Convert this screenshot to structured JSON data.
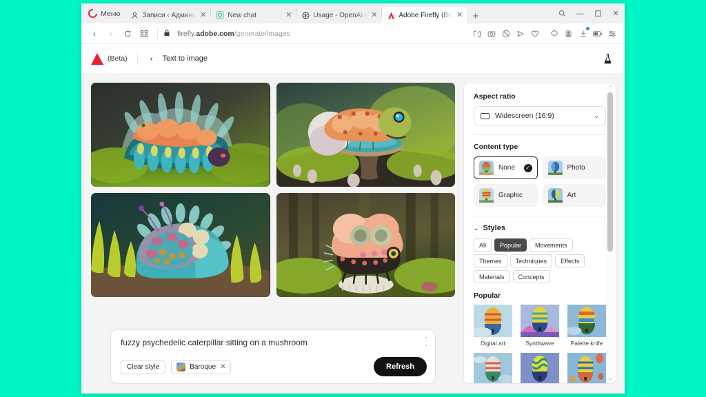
{
  "desktop": {
    "background_color": "#00f5c4"
  },
  "browser": {
    "menu": {
      "label": "Меню",
      "icon": "opera-logo-icon"
    },
    "tabs": [
      {
        "title": "Записи ‹ Админкин — Wo",
        "favicon": "user-icon",
        "active": false,
        "close": "✕"
      },
      {
        "title": "New chat",
        "favicon": "chat-icon",
        "active": false,
        "close": "✕"
      },
      {
        "title": "Usage - OpenAI API",
        "favicon": "openai-icon",
        "active": false,
        "close": "✕"
      },
      {
        "title": "Adobe Firefly (Beta)",
        "favicon": "adobe-firefly-icon",
        "active": true,
        "close": "✕"
      }
    ],
    "new_tab_label": "+",
    "window_controls": {
      "search": "search-icon",
      "minimize": "—",
      "maximize": "▢",
      "close": "✕"
    },
    "nav": {
      "back": "‹",
      "forward": "›",
      "reload": "⟳",
      "tabs_overview": "▤"
    },
    "address": {
      "lock": "lock-icon",
      "url_prefix": "firefly.",
      "url_host": "adobe.com",
      "url_path": "/generate/images"
    },
    "toolbar_icons": [
      "snapshot-icon",
      "camera-icon",
      "adblock-icon",
      "messenger-icon",
      "heart-icon",
      "extensions-icon",
      "profile-icon",
      "downloads-icon",
      "battery-icon",
      "settings-icon"
    ]
  },
  "app": {
    "logo": "adobe-firefly-logo",
    "beta_label": "(Beta)",
    "back_arrow": "‹",
    "page_title": "Text to image",
    "lab_icon": "flask-icon"
  },
  "results": {
    "images": [
      {
        "alt": "teal and orange fuzzy caterpillar on green moss"
      },
      {
        "alt": "orange spiky caterpillar sitting on a teal mushroom"
      },
      {
        "alt": "round teal caterpillar with berry textures and antennae"
      },
      {
        "alt": "fuzzy googly-eyed caterpillar on a white mushroom in forest"
      }
    ]
  },
  "prompt": {
    "text": "fuzzy psychedelic caterpillar sitting on a mushroom",
    "stepper_up": "⌃",
    "stepper_down": "⌄",
    "clear_style_label": "Clear style",
    "style_chip": {
      "label": "Baroque",
      "remove": "✕"
    },
    "refresh_label": "Refresh"
  },
  "panel": {
    "aspect_ratio": {
      "title": "Aspect ratio",
      "value": "Widescreen (16:9)",
      "caret": "⌄",
      "icon": "rectangle-icon"
    },
    "content_type": {
      "title": "Content type",
      "options": [
        {
          "label": "None",
          "selected": true,
          "check": "✓"
        },
        {
          "label": "Photo",
          "selected": false,
          "check": ""
        },
        {
          "label": "Graphic",
          "selected": false,
          "check": ""
        },
        {
          "label": "Art",
          "selected": false,
          "check": ""
        }
      ]
    },
    "styles": {
      "title": "Styles",
      "chevron": "⌄",
      "filters": [
        {
          "label": "All",
          "active": false
        },
        {
          "label": "Popular",
          "active": true
        },
        {
          "label": "Movements",
          "active": false
        },
        {
          "label": "Themes",
          "active": false
        },
        {
          "label": "Techniques",
          "active": false
        },
        {
          "label": "Effects",
          "active": false
        },
        {
          "label": "Materials",
          "active": false
        },
        {
          "label": "Concepts",
          "active": false
        }
      ],
      "group_title": "Popular",
      "items": [
        {
          "label": "Digital art"
        },
        {
          "label": "Synthwave"
        },
        {
          "label": "Palette knife"
        },
        {
          "label": ""
        },
        {
          "label": ""
        },
        {
          "label": ""
        }
      ]
    },
    "scrollbar": {
      "up": "⌃",
      "down": "⌄"
    }
  }
}
